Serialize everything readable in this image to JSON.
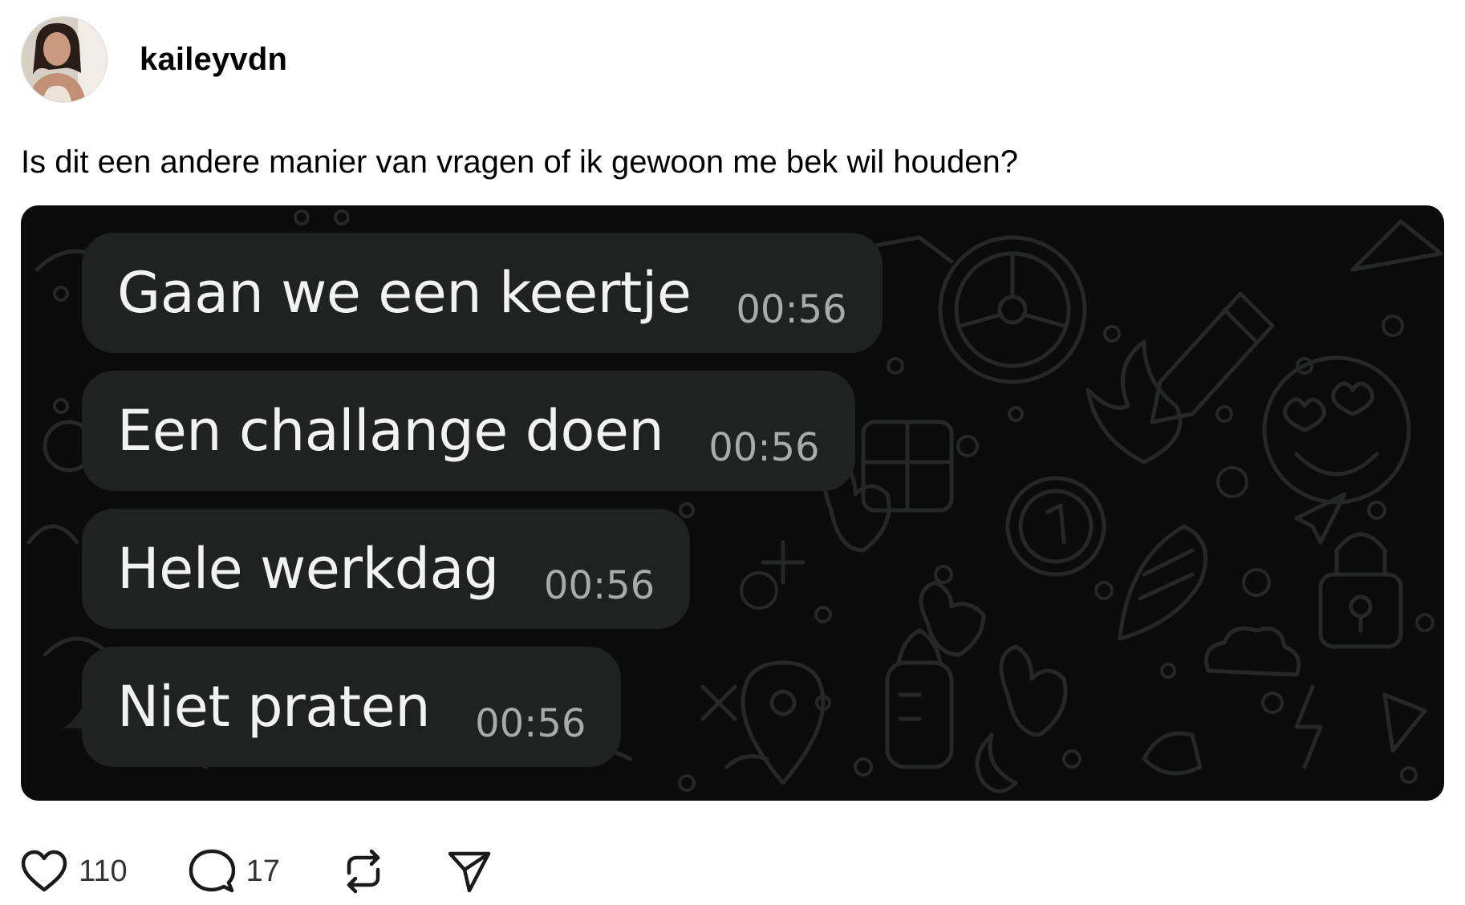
{
  "post": {
    "username": "kaileyvdn",
    "caption": "Is dit een andere manier van vragen of ik gewoon me bek wil houden?"
  },
  "chat": {
    "messages": [
      {
        "text": "Gaan we een keertje",
        "time": "00:56"
      },
      {
        "text": "Een challange doen",
        "time": "00:56"
      },
      {
        "text": "Hele werkdag",
        "time": "00:56"
      },
      {
        "text": "Niet praten",
        "time": "00:56"
      }
    ]
  },
  "actions": {
    "likes": "110",
    "comments": "17"
  },
  "icons": {
    "like": "heart-icon",
    "comment": "speech-bubble-icon",
    "repost": "repost-icon",
    "share": "send-icon"
  },
  "colors": {
    "chat_background": "#0b0b0b",
    "bubble": "#202121",
    "bubble_text": "#f2f2f2",
    "timestamp": "#a9aaaa"
  }
}
